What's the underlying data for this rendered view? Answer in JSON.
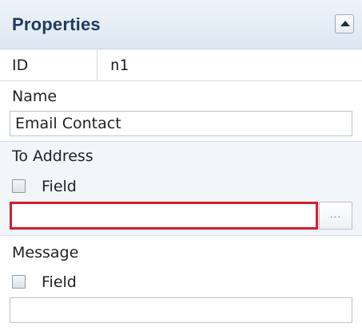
{
  "panel": {
    "title": "Properties"
  },
  "id_row": {
    "label": "ID",
    "value": "n1"
  },
  "name_section": {
    "label": "Name",
    "value": "Email Contact"
  },
  "to_address_section": {
    "label": "To Address",
    "field_checkbox_label": "Field",
    "field_checked": false,
    "value": "",
    "browse_label": "...",
    "error_color": "#d51e2a"
  },
  "message_section": {
    "label": "Message",
    "field_checkbox_label": "Field",
    "field_checked": false,
    "value": ""
  },
  "colors": {
    "header_title": "#1f3a5f",
    "highlight_section_bg": "#f2f5f9"
  }
}
